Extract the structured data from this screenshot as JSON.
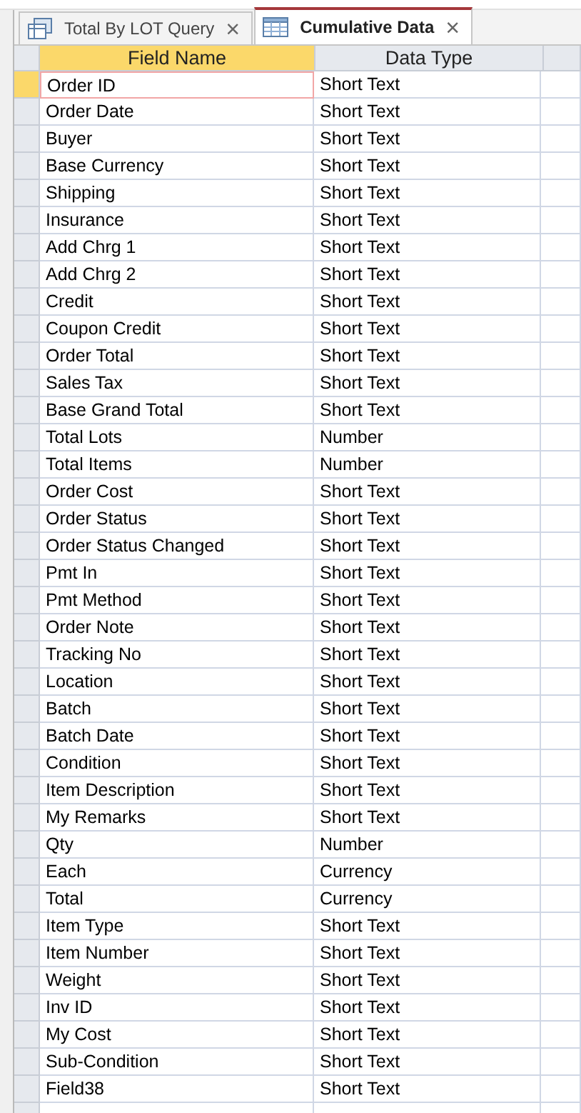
{
  "tabs": [
    {
      "label": "Total By LOT Query",
      "kind": "query",
      "selected": false,
      "close": "×"
    },
    {
      "label": "Cumulative Data",
      "kind": "table",
      "selected": true,
      "close": "×"
    }
  ],
  "table": {
    "columns": [
      "Field Name",
      "Data Type"
    ],
    "rows": [
      {
        "field": "Order ID",
        "type": "Short Text",
        "selected": true
      },
      {
        "field": "Order Date",
        "type": "Short Text",
        "selected": false
      },
      {
        "field": "Buyer",
        "type": "Short Text",
        "selected": false
      },
      {
        "field": "Base Currency",
        "type": "Short Text",
        "selected": false
      },
      {
        "field": "Shipping",
        "type": "Short Text",
        "selected": false
      },
      {
        "field": "Insurance",
        "type": "Short Text",
        "selected": false
      },
      {
        "field": "Add Chrg 1",
        "type": "Short Text",
        "selected": false
      },
      {
        "field": "Add Chrg 2",
        "type": "Short Text",
        "selected": false
      },
      {
        "field": "Credit",
        "type": "Short Text",
        "selected": false
      },
      {
        "field": "Coupon Credit",
        "type": "Short Text",
        "selected": false
      },
      {
        "field": "Order Total",
        "type": "Short Text",
        "selected": false
      },
      {
        "field": "Sales Tax",
        "type": "Short Text",
        "selected": false
      },
      {
        "field": "Base Grand Total",
        "type": "Short Text",
        "selected": false
      },
      {
        "field": "Total Lots",
        "type": "Number",
        "selected": false
      },
      {
        "field": "Total Items",
        "type": "Number",
        "selected": false
      },
      {
        "field": "Order Cost",
        "type": "Short Text",
        "selected": false
      },
      {
        "field": "Order Status",
        "type": "Short Text",
        "selected": false
      },
      {
        "field": "Order Status Changed",
        "type": "Short Text",
        "selected": false
      },
      {
        "field": "Pmt In",
        "type": "Short Text",
        "selected": false
      },
      {
        "field": "Pmt Method",
        "type": "Short Text",
        "selected": false
      },
      {
        "field": "Order Note",
        "type": "Short Text",
        "selected": false
      },
      {
        "field": "Tracking No",
        "type": "Short Text",
        "selected": false
      },
      {
        "field": "Location",
        "type": "Short Text",
        "selected": false
      },
      {
        "field": "Batch",
        "type": "Short Text",
        "selected": false
      },
      {
        "field": "Batch Date",
        "type": "Short Text",
        "selected": false
      },
      {
        "field": "Condition",
        "type": "Short Text",
        "selected": false
      },
      {
        "field": "Item Description",
        "type": "Short Text",
        "selected": false
      },
      {
        "field": "My Remarks",
        "type": "Short Text",
        "selected": false
      },
      {
        "field": "Qty",
        "type": "Number",
        "selected": false
      },
      {
        "field": "Each",
        "type": "Currency",
        "selected": false
      },
      {
        "field": "Total",
        "type": "Currency",
        "selected": false
      },
      {
        "field": "Item Type",
        "type": "Short Text",
        "selected": false
      },
      {
        "field": "Item Number",
        "type": "Short Text",
        "selected": false
      },
      {
        "field": "Weight",
        "type": "Short Text",
        "selected": false
      },
      {
        "field": "Inv ID",
        "type": "Short Text",
        "selected": false
      },
      {
        "field": "My Cost",
        "type": "Short Text",
        "selected": false
      },
      {
        "field": "Sub-Condition",
        "type": "Short Text",
        "selected": false
      },
      {
        "field": "Field38",
        "type": "Short Text",
        "selected": false
      }
    ]
  }
}
